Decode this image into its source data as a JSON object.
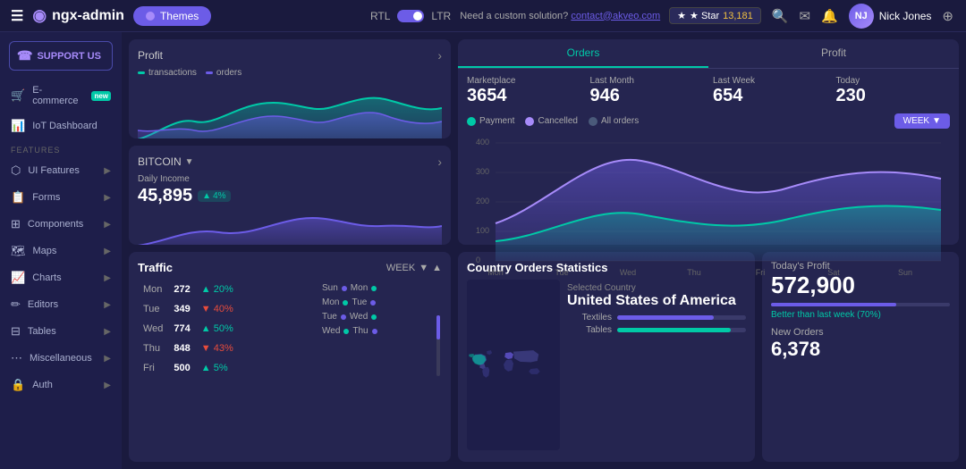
{
  "app": {
    "name": "ngx-admin",
    "hamburger": "☰",
    "logo_icon": "◉"
  },
  "topbar": {
    "themes_label": "Themes",
    "rtl_label": "RTL",
    "ltr_label": "LTR",
    "custom_text": "Need a custom solution?",
    "custom_link": "contact@akveo.com",
    "star_label": "★ Star",
    "star_count": "13,181",
    "user_name": "Nick Jones",
    "search_icon": "🔍",
    "mail_icon": "✉",
    "bell_icon": "🔔",
    "menu_icon": "☰"
  },
  "sidebar": {
    "support_label": "SUPPORT US",
    "items": [
      {
        "label": "E-commerce",
        "badge": "new",
        "icon": "🛒",
        "has_arrow": false
      },
      {
        "label": "IoT Dashboard",
        "icon": "📊",
        "has_arrow": false
      },
      {
        "section": "FEATURES"
      },
      {
        "label": "UI Features",
        "icon": "⬡",
        "has_arrow": true
      },
      {
        "label": "Forms",
        "icon": "📋",
        "has_arrow": true
      },
      {
        "label": "Components",
        "icon": "⊞",
        "has_arrow": true
      },
      {
        "label": "Maps",
        "icon": "🗺",
        "has_arrow": true
      },
      {
        "label": "Charts",
        "icon": "📈",
        "has_arrow": true
      },
      {
        "label": "Editors",
        "icon": "✏",
        "has_arrow": true
      },
      {
        "label": "Tables",
        "icon": "⊟",
        "has_arrow": true
      },
      {
        "label": "Miscellaneous",
        "icon": "⋯",
        "has_arrow": true
      },
      {
        "label": "Auth",
        "icon": "🔒",
        "has_arrow": true
      }
    ]
  },
  "profit_card": {
    "title": "Profit",
    "legend_transactions": "transactions",
    "legend_orders": "orders"
  },
  "bitcoin_card": {
    "title": "BITCOIN",
    "daily_income_label": "Daily Income",
    "daily_income_val": "45,895",
    "pct": "4%",
    "arrow": "▲"
  },
  "orders_panel": {
    "tabs": [
      "Orders",
      "Profit"
    ],
    "active_tab": 0,
    "stats": [
      {
        "label": "Marketplace",
        "value": "3654"
      },
      {
        "label": "Last Month",
        "value": "946"
      },
      {
        "label": "Last Week",
        "value": "654"
      },
      {
        "label": "Today",
        "value": "230"
      }
    ],
    "legend": [
      {
        "label": "Payment",
        "color_class": "ol-payment"
      },
      {
        "label": "Cancelled",
        "color_class": "ol-cancelled"
      },
      {
        "label": "All orders",
        "color_class": "ol-allorders"
      }
    ],
    "week_btn": "WEEK",
    "y_labels": [
      "400",
      "300",
      "200",
      "100",
      "0"
    ],
    "x_labels": [
      "Mon",
      "Tue",
      "Wed",
      "Thu",
      "Fri",
      "Sat",
      "Sun"
    ]
  },
  "traffic": {
    "title": "Traffic",
    "week_label": "WEEK",
    "rows": [
      {
        "day": "Mon",
        "num": "272",
        "pct": "20%",
        "dir": "up"
      },
      {
        "day": "Tue",
        "num": "349",
        "pct": "40%",
        "dir": "down"
      },
      {
        "day": "Wed",
        "num": "774",
        "pct": "50%",
        "dir": "up"
      },
      {
        "day": "Thu",
        "num": "848",
        "pct": "43%",
        "dir": "down"
      },
      {
        "day": "Fri",
        "num": "500",
        "pct": "5%",
        "dir": "up"
      }
    ],
    "mini_rows": [
      {
        "label1": "Sun",
        "dot1": "mini-dot-sun",
        "label2": "Mon",
        "dot2": "mini-dot-mon"
      },
      {
        "label1": "Mon",
        "dot1": "mini-dot-mon",
        "label2": "Tue",
        "dot2": "mini-dot-sun"
      },
      {
        "label1": "Tue",
        "dot1": "mini-dot-sun",
        "label2": "Wed",
        "dot2": "mini-dot-mon"
      },
      {
        "label1": "Wed",
        "dot1": "mini-dot-mon",
        "label2": "Thu",
        "dot2": "mini-dot-sun"
      }
    ]
  },
  "country": {
    "title": "Country Orders Statistics",
    "selected_label": "Selected Country",
    "country_name": "United States of America",
    "bars": [
      {
        "label": "Textiles",
        "class": "bar-textiles"
      },
      {
        "label": "Tables",
        "class": "bar-tables"
      }
    ]
  },
  "todays_profit": {
    "label": "Today's Profit",
    "value": "572,900",
    "sub_text": "Better than last week (70%)",
    "new_orders_label": "New Orders",
    "new_orders_value": "6,378"
  }
}
